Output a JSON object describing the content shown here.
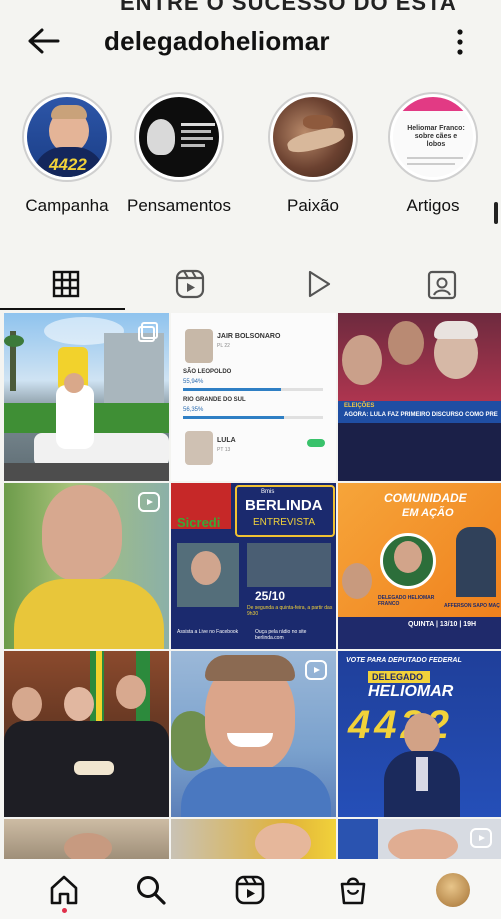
{
  "header": {
    "username": "delegadoheliomar"
  },
  "highlights": [
    {
      "label": "Campanha",
      "badge": "4422"
    },
    {
      "label": "Pensamentos"
    },
    {
      "label": "Paixão"
    },
    {
      "label": "Artigos",
      "title": "Heliomar Franco: sobre cães e lobos"
    }
  ],
  "grid": {
    "poll": {
      "c1_name": "JAIR BOLSONARO",
      "c1_party": "PL 22",
      "city1": "SÃO LEOPOLDO",
      "city1_pct": "55,94%",
      "city2": "RIO GRANDE DO SUL",
      "city2_pct": "56,35%",
      "c2_name": "LULA",
      "c2_party": "PT 13"
    },
    "lula": {
      "tag": "ELEIÇÕES",
      "headline": "AGORA: LULA FAZ PRIMEIRO DISCURSO COMO PRE"
    },
    "berlinda": {
      "brand": "Sicredi",
      "small": "Bmis",
      "title": "BERLINDA",
      "subtitle": "ENTREVISTA",
      "date": "25/10",
      "schedule": "De segunda a quinta-feira, a partir das 9h30",
      "facebook": "Assista a Live no Facebook",
      "radio": "Ouça pela rádio no site berlinda.com"
    },
    "comunidade": {
      "title1": "COMUNIDADE",
      "title2": "EM AÇÃO",
      "guest1": "DELEGADO HELIOMAR FRANCO",
      "guest2": "AFFERSON SAPO MAÇ",
      "date": "QUINTA | 13/10 | 19H"
    },
    "vote": {
      "top": "VOTE PARA DEPUTADO FEDERAL",
      "tag": "DELEGADO",
      "name": "HELIOMAR",
      "number": "4422"
    }
  },
  "colors": {
    "background": "#f4f4f1",
    "text": "#111111",
    "navy": "#1f2a6b",
    "orange": "#f08a1e",
    "yellow": "#f1d23a",
    "red": "#c8213a",
    "sicredi_green": "#39a935",
    "notification": "#e0304a"
  },
  "icons": {
    "back": "arrow-left-icon",
    "more": "more-vertical-icon",
    "grid_tab": "grid-icon",
    "reels_tab": "reels-icon",
    "video_tab": "play-icon",
    "tagged_tab": "tagged-icon",
    "nav": [
      "home-icon",
      "search-icon",
      "reels-icon",
      "shop-icon",
      "profile-avatar"
    ]
  }
}
